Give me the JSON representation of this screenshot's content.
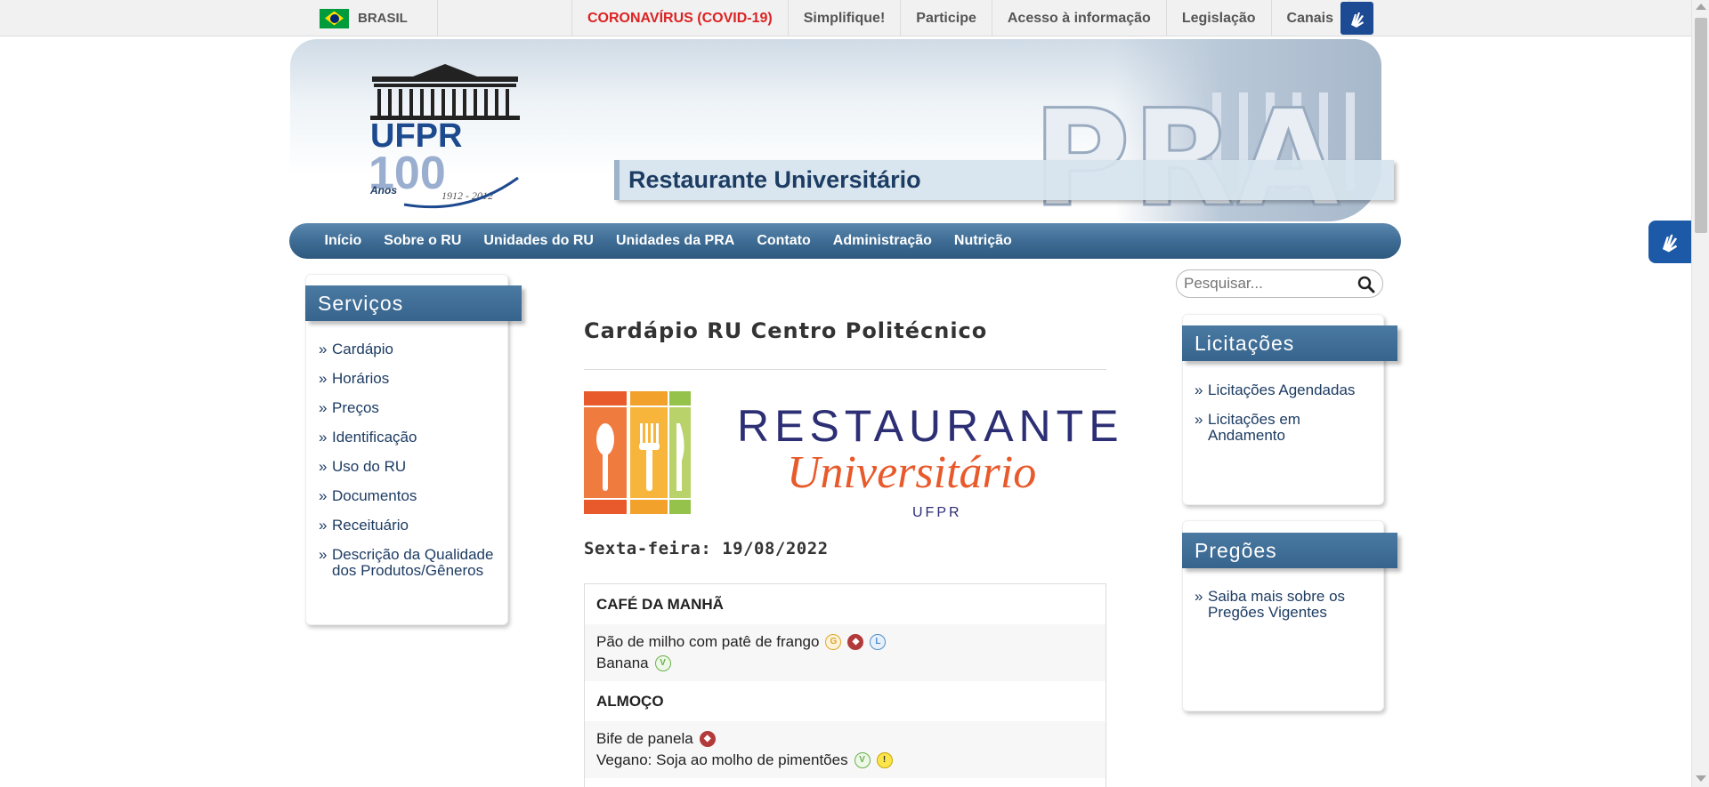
{
  "govbar": {
    "brasil_label": "BRASIL",
    "links": [
      "CORONAVÍRUS (COVID-19)",
      "Simplifique!",
      "Participe",
      "Acesso à informação",
      "Legislação",
      "Canais"
    ]
  },
  "header": {
    "logo_text": "UFPR",
    "logo_years": "100",
    "logo_anos": "Anos",
    "logo_range": "1912 - 2012",
    "pra_text": "PRA",
    "site_title": "Restaurante Universitário"
  },
  "nav": {
    "items": [
      "Início",
      "Sobre o RU",
      "Unidades do RU",
      "Unidades da PRA",
      "Contato",
      "Administração",
      "Nutrição"
    ]
  },
  "servicos": {
    "title": "Serviços",
    "items": [
      "Cardápio",
      "Horários",
      "Preços",
      "Identificação",
      "Uso do RU",
      "Documentos",
      "Receituário",
      "Descrição da Qualidade dos Produtos/Gêneros"
    ]
  },
  "search": {
    "placeholder": "Pesquisar..."
  },
  "licitacoes": {
    "title": "Licitações",
    "items": [
      "Licitações Agendadas",
      "Licitações em Andamento"
    ]
  },
  "pregoes": {
    "title": "Pregões",
    "items": [
      "Saiba mais sobre os Pregões Vigentes"
    ]
  },
  "content": {
    "title": "Cardápio RU Centro Politécnico",
    "ru_logo": {
      "word1": "RESTAURANTE",
      "word2": "Universitário",
      "word3": "UFPR"
    },
    "date": "Sexta-feira: 19/08/2022",
    "meals": [
      {
        "name": "CAFÉ DA MANHÃ",
        "lines": [
          {
            "text": "Pão de milho com patê de frango",
            "icons": [
              "gluten-icon",
              "animal-origin-icon",
              "lactose-icon"
            ]
          },
          {
            "text": "Banana",
            "icons": [
              "vegan-icon"
            ]
          }
        ]
      },
      {
        "name": "ALMOÇO",
        "lines": [
          {
            "text": "Bife de panela",
            "icons": [
              "animal-origin-icon"
            ]
          },
          {
            "text": "Vegano: Soja ao molho de pimentões",
            "icons": [
              "vegan-icon",
              "alert-icon"
            ]
          }
        ]
      }
    ]
  },
  "colors": {
    "nav_blue": "#3c6a92",
    "title_blue": "#1d3c63",
    "covid_red": "#d22222",
    "ru_orange": "#e85a2b",
    "ru_navy": "#2d2f75"
  }
}
